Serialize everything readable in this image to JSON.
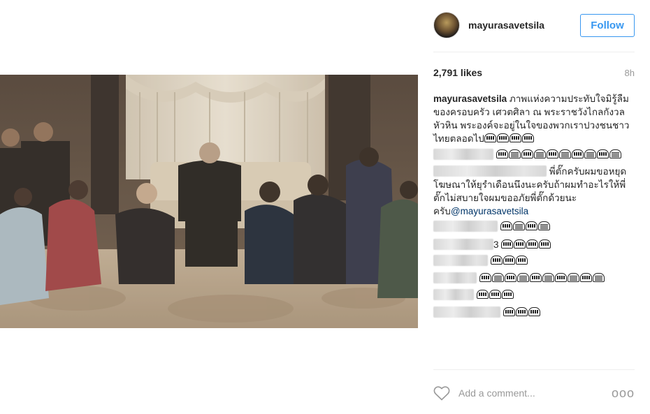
{
  "post": {
    "username": "mayurasavetsila",
    "follow_label": "Follow",
    "likes": "2,791 likes",
    "time": "8h"
  },
  "caption": {
    "username": "mayurasavetsila",
    "text": " ภาพแห่งความประทับใจมิรู้ลืมของครอบครัว เศวตศิลา ณ พระราชวังไกลกังวล หัวหิน พระองค์จะอยู่ในใจของพวกเราปวงชนชาวไทยตลอดไป"
  },
  "comments": [
    {
      "text": ""
    },
    {
      "text": "พี่ตั๊กครับผมขอหยุดโฆษณาให้ยุรำเดือนนึงนะครับถ้าผมทำอะไรให้พี่ตั๊กไม่สบายใจผมขออภัยพี่ตั๊กด้วยนะครับ",
      "mention": "@mayurasavetsila"
    },
    {
      "text": ""
    },
    {
      "text": "3"
    },
    {
      "text": ""
    },
    {
      "text": ""
    },
    {
      "text": ""
    },
    {
      "text": ""
    }
  ],
  "footer": {
    "add_comment_placeholder": "Add a comment...",
    "more_label": "ooo"
  },
  "icons": {
    "heart": "heart-icon",
    "more": "more-options-icon",
    "emoji": "emoji-icon"
  },
  "colors": {
    "accent": "#3897f0",
    "mention": "#003569",
    "muted": "#999999"
  }
}
